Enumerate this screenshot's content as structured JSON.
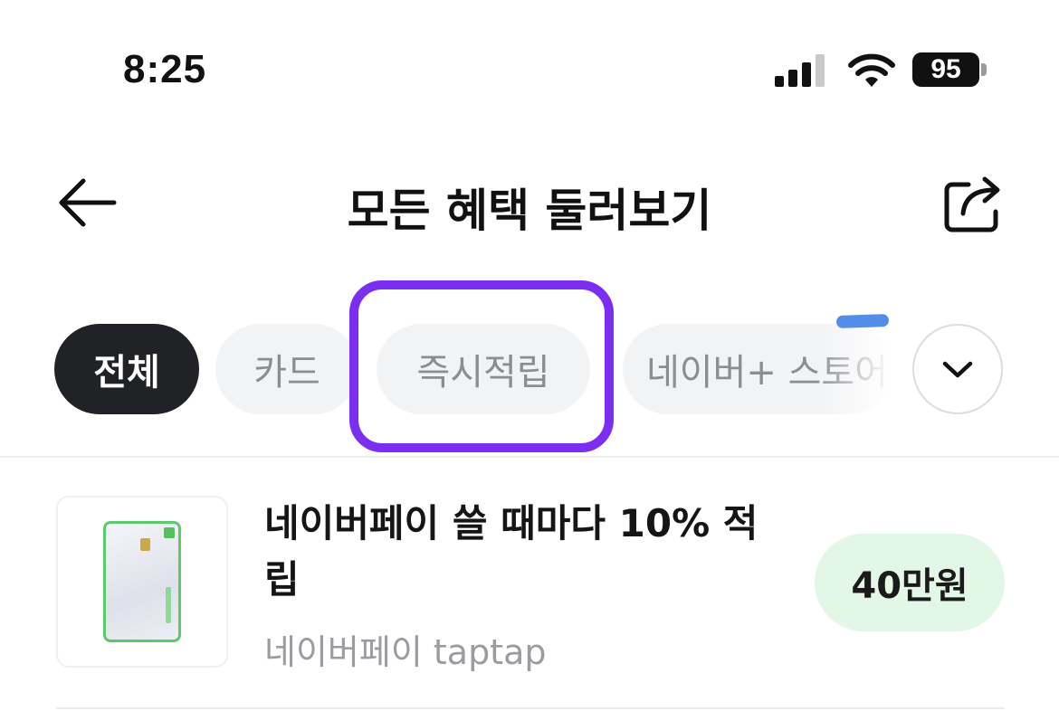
{
  "status_bar": {
    "time": "8:25",
    "battery": "95",
    "signal_icon": "cellular-signal-icon",
    "wifi_icon": "wifi-icon"
  },
  "header": {
    "title": "모든 혜택 둘러보기",
    "back_icon": "arrow-left-icon",
    "share_icon": "share-icon"
  },
  "filters": {
    "chips": [
      {
        "label": "전체",
        "active": true
      },
      {
        "label": "카드",
        "active": false
      },
      {
        "label": "즉시적립",
        "active": false
      },
      {
        "label": "네이버+ 스토어",
        "active": false
      }
    ],
    "expand_icon": "chevron-down-icon",
    "highlight_color": "#7c2ef0"
  },
  "benefits": [
    {
      "title": "네이버페이 쓸 때마다 10% 적립",
      "subtitle": "네이버페이 taptap",
      "reward": "40만원",
      "thumbnail": "credit-card-image"
    }
  ],
  "colors": {
    "active_chip": "#212226",
    "reward_badge_bg": "#e3f7e6"
  }
}
